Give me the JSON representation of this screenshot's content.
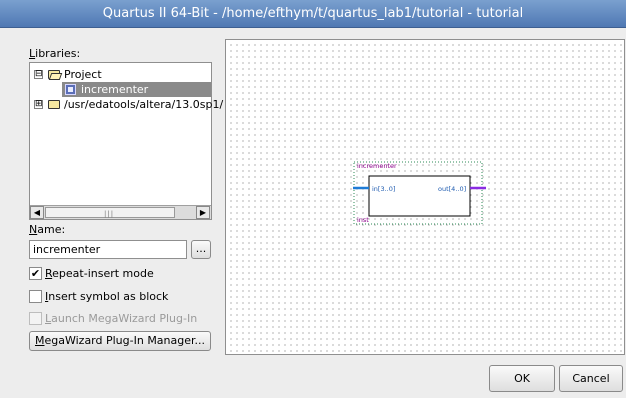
{
  "window": {
    "title": "Quartus II 64-Bit - /home/efthym/t/quartus_lab1/tutorial - tutorial"
  },
  "libraries": {
    "label_mnemonic": "L",
    "label_rest": "ibraries:",
    "tree": [
      {
        "expander": "⊟",
        "label": "Project"
      },
      {
        "label": "incrementer"
      },
      {
        "expander": "⊞",
        "label": "/usr/edatools/altera/13.0sp1/"
      }
    ],
    "scroll_grip": "|||"
  },
  "name": {
    "label_mnemonic": "N",
    "label_rest": "ame:",
    "value": "incrementer",
    "browse_label": "..."
  },
  "options": {
    "repeat_insert": {
      "mnemonic": "R",
      "rest": "epeat-insert mode",
      "checked": true,
      "mark": "✔"
    },
    "insert_block": {
      "mnemonic": "I",
      "rest": "nsert symbol as block",
      "checked": false
    },
    "launch_megawizard": {
      "mnemonic": "L",
      "rest": "aunch MegaWizard Plug-In",
      "checked": false
    }
  },
  "megawizard_button": {
    "mnemonic": "M",
    "rest": "egaWizard Plug-In Manager..."
  },
  "symbol": {
    "name": "incrementer",
    "input_port": "in[3..0]",
    "output_port": "out[4..0]",
    "instance": "inst"
  },
  "buttons": {
    "ok": "OK",
    "cancel": "Cancel"
  },
  "colors": {
    "title_bar": "#5f86bf",
    "input_wire": "#1e7bd6",
    "output_wire": "#8a2be2",
    "symbol_text": "#8b008b",
    "selection": "#8a8a8a"
  }
}
